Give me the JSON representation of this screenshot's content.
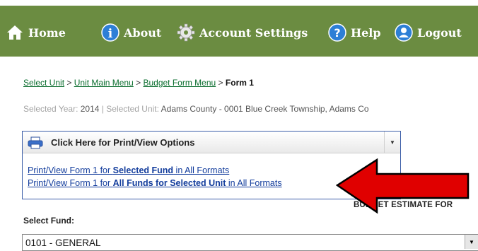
{
  "nav": {
    "home": "Home",
    "about": "About",
    "account_settings": "Account Settings",
    "help": "Help",
    "logout": "Logout"
  },
  "breadcrumb": {
    "select_unit": "Select Unit",
    "sep": ">",
    "unit_main_menu": "Unit Main Menu",
    "budget_form_menu": "Budget Form Menu",
    "current": "Form 1"
  },
  "selection": {
    "year_label": "Selected Year:",
    "year_value": "2014",
    "divider": "|",
    "unit_label": "Selected Unit:",
    "unit_value": "Adams County - 0001 Blue Creek Township, Adams Co"
  },
  "print_panel": {
    "header": "Click Here for Print/View Options",
    "link1": {
      "prefix": "Print/View Form 1 for ",
      "bold": "Selected Fund",
      "suffix": " in All Formats"
    },
    "link2": {
      "prefix": "Print/View Form 1 for ",
      "bold": "All Funds for Selected Unit",
      "suffix": " in All Formats"
    }
  },
  "budget_heading": "BUDGET ESTIMATE FOR",
  "fund": {
    "label": "Select Fund:",
    "selected": "0101 - GENERAL"
  },
  "colors": {
    "navbar": "#6b8c41",
    "breadcrumb_link": "#0b6e2f",
    "panel_border": "#3c5ea8",
    "print_link": "#123c9c",
    "arrow": "#e00000"
  }
}
